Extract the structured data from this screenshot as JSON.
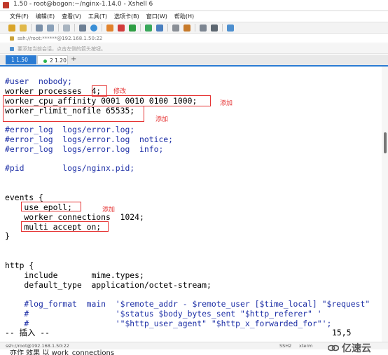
{
  "window": {
    "title": "1.50 - root@bogon:~/nginx-1.14.0 - Xshell 6"
  },
  "menu": [
    "文件(F)",
    "编辑(E)",
    "查看(V)",
    "工具(T)",
    "选项卡(B)",
    "窗口(W)",
    "帮助(H)"
  ],
  "address": {
    "text": "ssh://root:******@192.168.1.50:22"
  },
  "hint": {
    "text": "要添加当前会话，点击左侧的箭头按钮。"
  },
  "tabs": [
    {
      "label": "1 1.50",
      "active": true
    },
    {
      "label": "2 1.20",
      "active": false
    }
  ],
  "tab_add": "+",
  "editor": {
    "lines": [
      "#user  nobody;",
      "worker_processes  4;",
      "worker_cpu_affinity 0001 0010 0100 1000;",
      "worker_rlimit_nofile 65535;",
      "#error_log  logs/error.log;",
      "#error_log  logs/error.log  notice;",
      "#error_log  logs/error.log  info;",
      "#pid        logs/nginx.pid;",
      "events {",
      "    use epoll;",
      "    worker_connections  1024;",
      "    multi_accept on;",
      "}",
      "http {",
      "    include       mime.types;",
      "    default_type  application/octet-stream;",
      "    #log_format  main  '$remote_addr - $remote_user [$time_local] \"$request\"",
      "    #                  '$status $body_bytes_sent \"$http_referer\" '",
      "    #                  '\"$http_user_agent\" \"$http_x_forwarded_for\"';",
      "-- 插入 --",
      "15,5"
    ]
  },
  "annotations": {
    "modify": "修改",
    "add1": "添加",
    "add2": "添加",
    "add3": "添加"
  },
  "status": {
    "connection": "ssh://root@192.168.1.50:22",
    "protocol": "SSH2",
    "terminal": "xterm"
  },
  "bottom_cutoff": "亦作 效果 以 work_connections",
  "watermark": {
    "text": "亿速云"
  },
  "colors": {
    "accent": "#2a7bd3",
    "annotation": "#e53333",
    "code_blue": "#1d2fa6"
  }
}
